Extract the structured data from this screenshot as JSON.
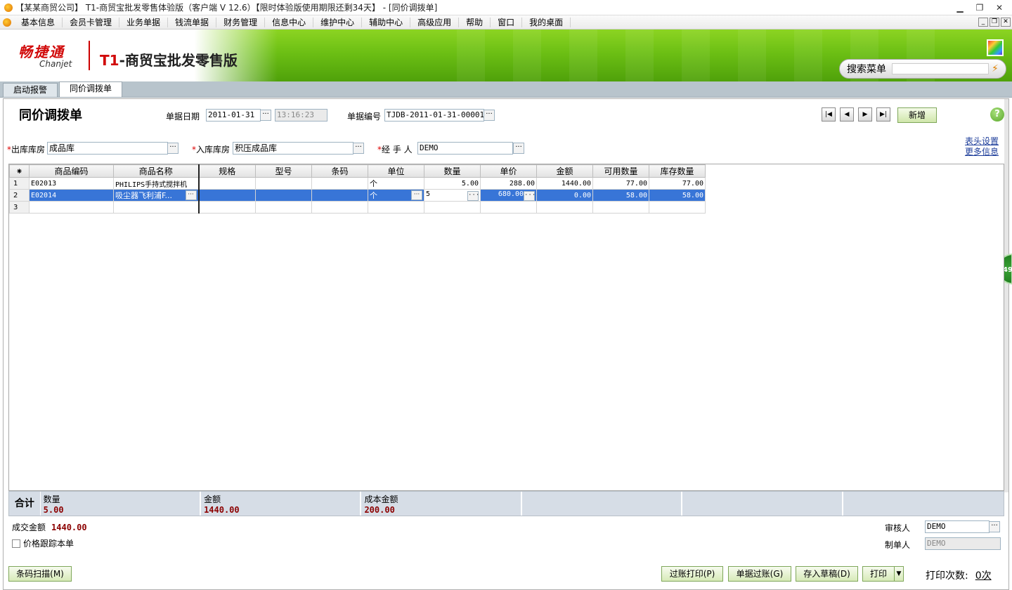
{
  "window": {
    "title": "【某某商贸公司】 T1-商贸宝批发零售体验版（客户端 V 12.6）【限时体验版使用期限还剩34天】 - [同价调拨单]"
  },
  "menu": [
    "基本信息",
    "会员卡管理",
    "业务单据",
    "钱流单据",
    "财务管理",
    "信息中心",
    "维护中心",
    "辅助中心",
    "高级应用",
    "帮助",
    "窗口",
    "我的桌面"
  ],
  "banner": {
    "logo_cn": "畅捷通",
    "logo_en": "Chanjet",
    "product_prefix": "T1",
    "product_rest": "-商贸宝批发零售版",
    "search_label": "搜索菜单",
    "search_value": ""
  },
  "tabs": [
    {
      "label": "启动报警",
      "active": false
    },
    {
      "label": "同价调拨单",
      "active": true
    }
  ],
  "header": {
    "doc_title": "同价调拨单",
    "date_label": "单据日期",
    "date_value": "2011-01-31",
    "time_value": "13:16:23",
    "number_label": "单据编号",
    "number_value": "TJDB-2011-01-31-00001",
    "new_button": "新增",
    "help": "?",
    "out_wh_label": "出库库房",
    "out_wh_value": "成品库",
    "in_wh_label": "入库库房",
    "in_wh_value": "积压成品库",
    "handler_label": "经 手 人",
    "handler_value": "DEMO",
    "link_header_settings": "表头设置",
    "link_more_info": "更多信息",
    "side_badge": "49"
  },
  "grid": {
    "columns": [
      "商品编码",
      "商品名称",
      "规格",
      "型号",
      "条码",
      "单位",
      "数量",
      "单价",
      "金额",
      "可用数量",
      "库存数量"
    ],
    "rows": [
      {
        "n": "1",
        "code": "E02013",
        "name": "PHILIPS手持式搅拌机",
        "spec": "",
        "model": "",
        "barcode": "",
        "unit": "个",
        "qty": "5.00",
        "price": "288.00",
        "amount": "1440.00",
        "avail": "77.00",
        "stock": "77.00"
      },
      {
        "n": "2",
        "code": "E02014",
        "name": "吸尘器飞利浦F...",
        "spec": "",
        "model": "",
        "barcode": "",
        "unit": "个",
        "qty": "5",
        "price": "680.00",
        "amount": "0.00",
        "avail": "58.00",
        "stock": "58.00"
      },
      {
        "n": "3",
        "code": "",
        "name": "",
        "spec": "",
        "model": "",
        "barcode": "",
        "unit": "",
        "qty": "",
        "price": "",
        "amount": "",
        "avail": "",
        "stock": ""
      }
    ]
  },
  "totals": {
    "label": "合计",
    "qty_label": "数量",
    "qty_value": "5.00",
    "amount_label": "金额",
    "amount_value": "1440.00",
    "cost_label": "成本金额",
    "cost_value": "200.00"
  },
  "footer": {
    "deal_label": "成交金额",
    "deal_value": "1440.00",
    "price_track_label": "价格跟踪本单",
    "auditor_label": "审核人",
    "auditor_value": "DEMO",
    "maker_label": "制单人",
    "maker_value": "DEMO",
    "barcode_button": "条码扫描(M)",
    "post_print_button": "过账打印(P)",
    "post_button": "单据过账(G)",
    "draft_button": "存入草稿(D)",
    "print_button": "打印",
    "print_count_label": "打印次数:",
    "print_count_value": "0次"
  },
  "colors": {
    "banner_green": "#6cbf14",
    "selection_blue": "#3875d7",
    "total_value": "#8b0000"
  }
}
